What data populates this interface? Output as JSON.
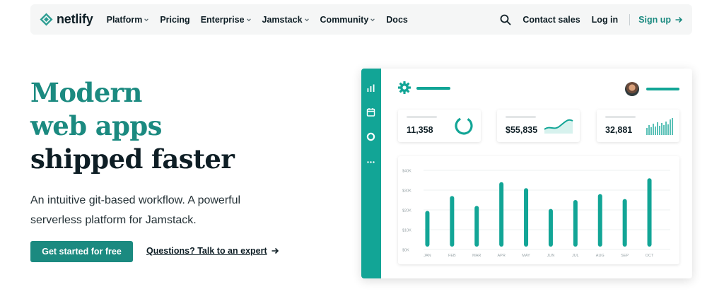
{
  "brand": {
    "name": "netlify",
    "color": "#1b8a80"
  },
  "nav": {
    "items": [
      {
        "label": "Platform",
        "has_dropdown": true
      },
      {
        "label": "Pricing",
        "has_dropdown": false
      },
      {
        "label": "Enterprise",
        "has_dropdown": true
      },
      {
        "label": "Jamstack",
        "has_dropdown": true
      },
      {
        "label": "Community",
        "has_dropdown": true
      },
      {
        "label": "Docs",
        "has_dropdown": false
      }
    ],
    "contact": "Contact sales",
    "login": "Log in",
    "signup": "Sign up"
  },
  "hero": {
    "title_line1": "Modern",
    "title_line2": "web apps",
    "title_line3": "shipped faster",
    "subtitle": "An intuitive git-based workflow. A powerful serverless platform for Jamstack.",
    "cta_primary": "Get started for free",
    "cta_secondary": "Questions? Talk to an expert"
  },
  "dashboard": {
    "accent": "#12a596",
    "sidebar_icons": [
      "bar-chart-icon",
      "calendar-icon",
      "lifebuoy-icon",
      "more-icon"
    ],
    "stats": [
      {
        "value": "11,358",
        "graphic": "ring"
      },
      {
        "value": "$55,835",
        "graphic": "wave"
      },
      {
        "value": "32,881",
        "graphic": "sparkbars"
      }
    ]
  },
  "chart_data": {
    "type": "bar",
    "title": "",
    "xlabel": "",
    "ylabel": "",
    "categories": [
      "JAN",
      "FEB",
      "MAR",
      "APR",
      "MAY",
      "JUN",
      "JUL",
      "AUG",
      "SEP",
      "OCT"
    ],
    "values": [
      19500,
      27000,
      22000,
      34000,
      31000,
      20500,
      25000,
      28000,
      25500,
      36000
    ],
    "ylim": [
      0,
      40000
    ],
    "yticks": [
      "$0K",
      "$10K",
      "$20K",
      "$30K",
      "$40K"
    ],
    "grid": true,
    "color": "#12a596"
  }
}
